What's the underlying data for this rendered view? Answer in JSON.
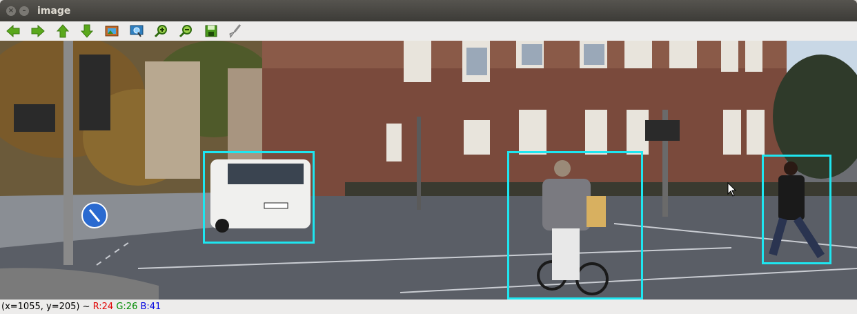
{
  "window": {
    "title": "image"
  },
  "toolbar": {
    "buttons": [
      {
        "name": "back-arrow-icon"
      },
      {
        "name": "forward-arrow-icon"
      },
      {
        "name": "up-arrow-icon"
      },
      {
        "name": "down-arrow-icon"
      },
      {
        "name": "fit-image-icon"
      },
      {
        "name": "zoom-region-icon"
      },
      {
        "name": "zoom-in-icon"
      },
      {
        "name": "zoom-out-icon"
      },
      {
        "name": "save-icon"
      },
      {
        "name": "properties-brush-icon"
      }
    ]
  },
  "status": {
    "coords": "(x=1055, y=205) ~ ",
    "r": "R:24",
    "g": "G:26",
    "b": "B:41",
    "colors": {
      "r": "#e00000",
      "g": "#008a00",
      "b": "#0000e0"
    }
  },
  "detections": [
    {
      "label": "van"
    },
    {
      "label": "cyclist"
    },
    {
      "label": "pedestrian"
    }
  ],
  "colors": {
    "bbox": "#1ee6f0"
  }
}
